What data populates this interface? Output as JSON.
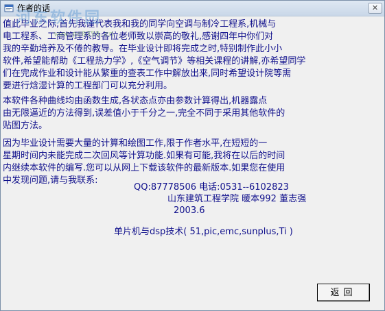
{
  "window": {
    "title": "作者的话",
    "close_label": "✕"
  },
  "watermark": {
    "text": "河东软件园",
    "url": "www.pc0359.cn"
  },
  "content": {
    "paragraph1": [
      "    值此毕业之际,首先我谨代表我和我的同学向空调与制冷工程系,机械与",
      "电工程系、工商管理系的各位老师致以崇高的敬礼,感谢四年中你们对",
      "我的辛勤培养及不倦的教导。在毕业设计即将完成之时,特别制作此小小",
      "软件,希望能帮助《工程热力学》,《空气调节》等相关课程的讲解,亦希望同学",
      "们在完成作业和设计能从繁重的查表工作中解放出来,同时希望设计院等需",
      "  要进行焓湿计算的工程部门可以充分利用。"
    ],
    "paragraph2": [
      "      本软件各种曲线均由函数生成,各状态点亦由参数计算得出,机器露点",
      "  由无限逼近的方法得到,误差值小于千分之一,完全不同于采用其他软件的",
      "  贴图方法。"
    ],
    "paragraph3": [
      "      因为毕业设计需要大量的计算和绘图工作,限于作者水平,在短短的一",
      "星期时间内未能完成二次回风等计算功能.如果有可能,我将在以后的时间",
      "内继续本软件的编写.您可以从网上下载该软件的最新版本.如果您在使用",
      "中发现问题,请与我联系:"
    ],
    "contact": {
      "qq": "QQ:87778506       电话:0531--6102823",
      "school": "山东建筑工程学院 暖本992 董志强",
      "date": "2003.6",
      "note": "单片机与dsp技术( 51,pic,emc,sunplus,Ti )"
    }
  },
  "buttons": {
    "back_label": "返回"
  },
  "colors": {
    "text": "#10108c",
    "background": "#f0f0f0"
  }
}
